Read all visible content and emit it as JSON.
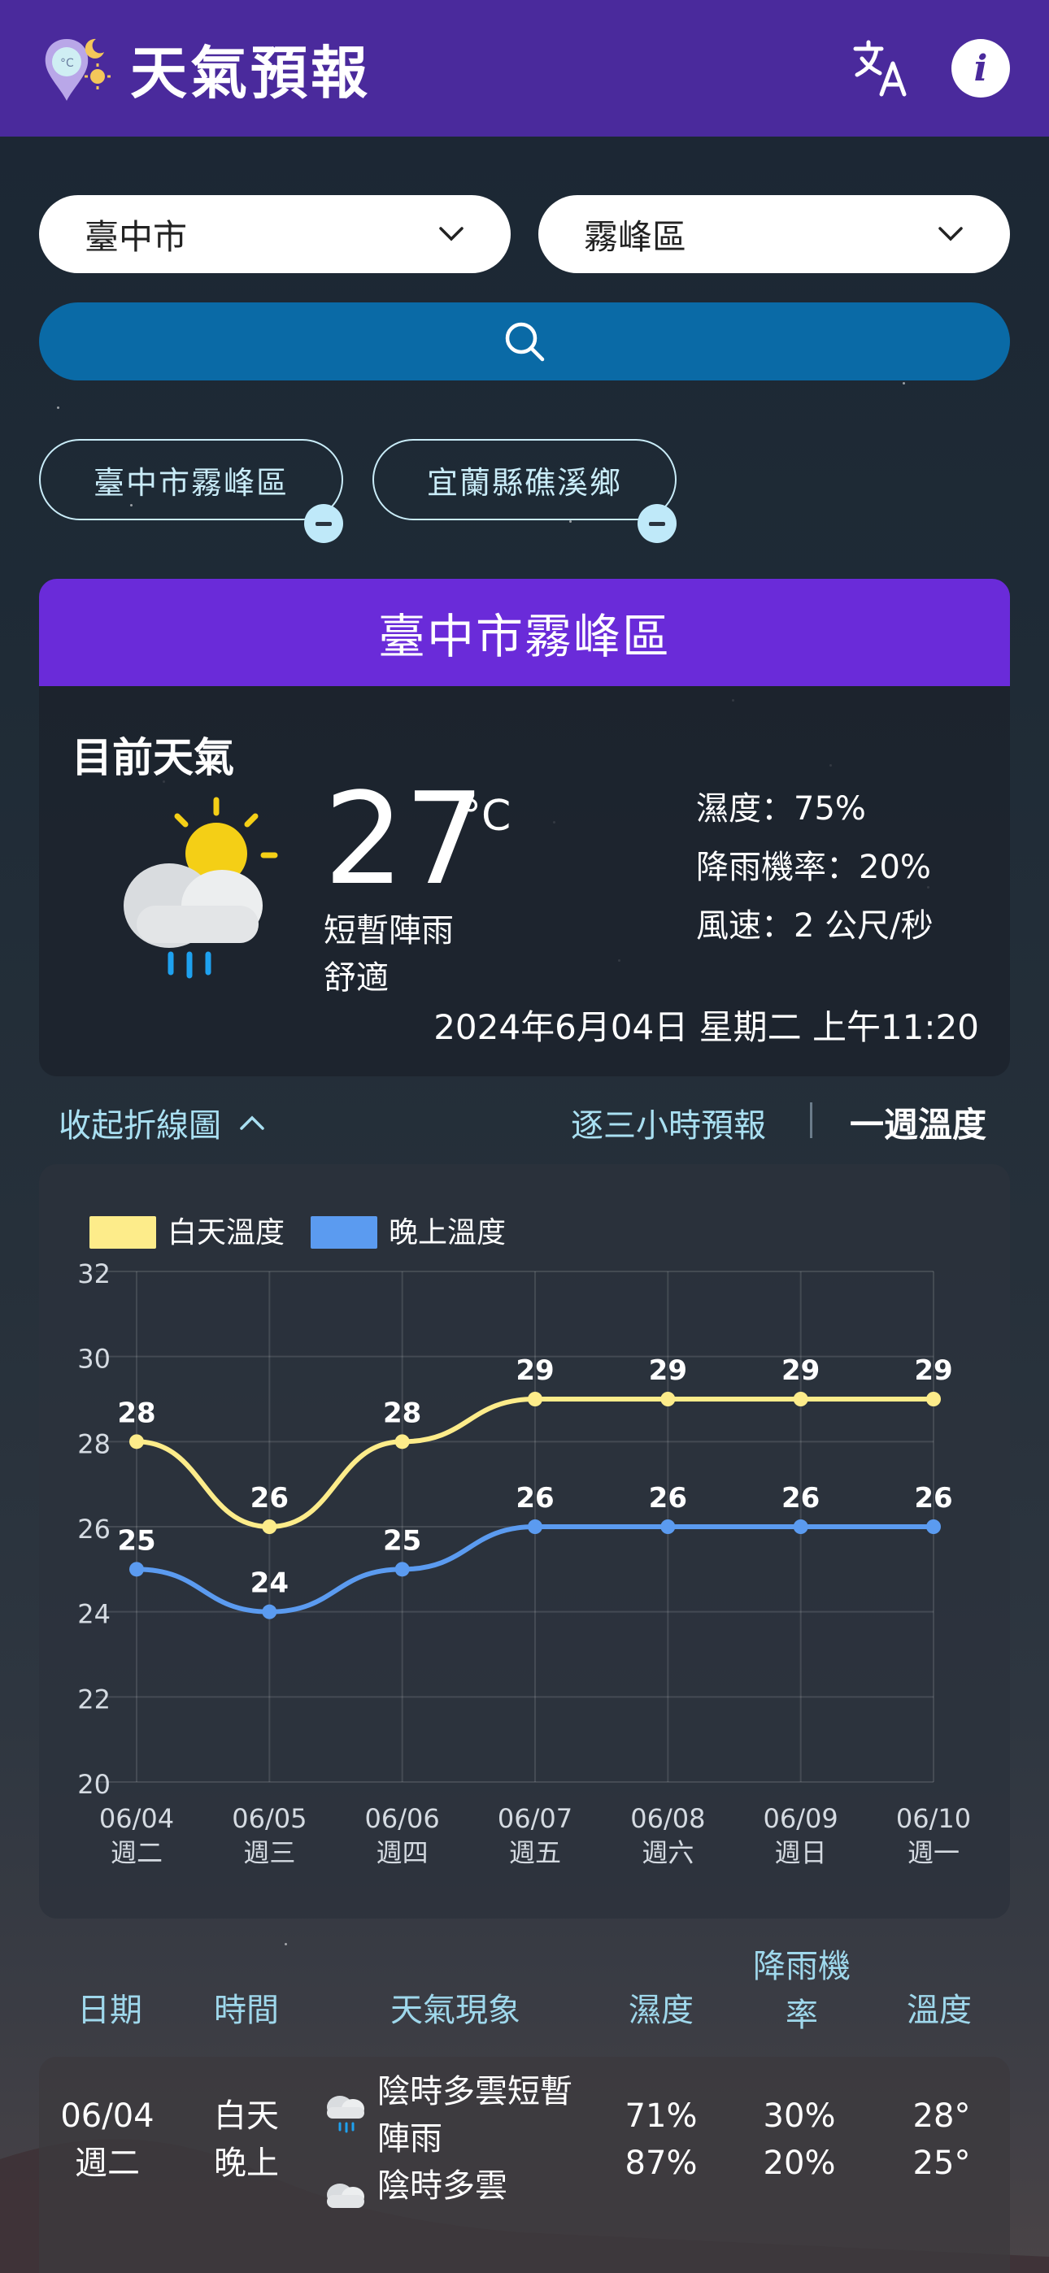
{
  "header": {
    "title": "天氣預報",
    "translate_icon": "translate-icon",
    "info_label": "i"
  },
  "selectors": {
    "city": "臺中市",
    "district": "霧峰區"
  },
  "search": {
    "icon": "search-icon"
  },
  "favorites": [
    {
      "label": "臺中市霧峰區"
    },
    {
      "label": "宜蘭縣礁溪鄉"
    }
  ],
  "current": {
    "location": "臺中市霧峰區",
    "label": "目前天氣",
    "temp": "27",
    "unit": "°C",
    "desc": "短暫陣雨",
    "comfort": "舒適",
    "humidity": "濕度：75%",
    "rain": "降雨機率：20%",
    "wind": "風速：2 公尺/秒",
    "datetime": "2024年6月04日 星期二 上午11:20"
  },
  "tabs": {
    "collapse": "收起折線圖",
    "three_hour": "逐三小時預報",
    "week": "一週溫度"
  },
  "colors": {
    "header": "#4a2a9c",
    "accent": "#6a2bd9",
    "day": "#fdec8a",
    "night": "#5b9bf0"
  },
  "chart_data": {
    "type": "line",
    "categories": [
      "06/04",
      "06/05",
      "06/06",
      "06/07",
      "06/08",
      "06/09",
      "06/10"
    ],
    "category_sub": [
      "週二",
      "週三",
      "週四",
      "週五",
      "週六",
      "週日",
      "週一"
    ],
    "series": [
      {
        "name": "白天溫度",
        "values": [
          28,
          26,
          28,
          29,
          29,
          29,
          29
        ]
      },
      {
        "name": "晚上溫度",
        "values": [
          25,
          24,
          25,
          26,
          26,
          26,
          26
        ]
      }
    ],
    "ylim": [
      20,
      32
    ],
    "yticks": [
      20,
      22,
      24,
      26,
      28,
      30,
      32
    ],
    "grid": true,
    "legend": "top-left",
    "smooth": true
  },
  "table": {
    "headers": [
      "日期",
      "時間",
      "天氣現象",
      "濕度",
      "降雨機",
      "率",
      "溫度"
    ],
    "row": {
      "date": "06/04",
      "weekday": "週二",
      "day_label": "白天",
      "night_label": "晚上",
      "day_wx_1": "陰時多雲短暫",
      "day_wx_2": "陣雨",
      "night_wx": "陰時多雲",
      "day_humidity": "71%",
      "night_humidity": "87%",
      "day_rain": "30%",
      "night_rain": "20%",
      "day_temp": "28°",
      "night_temp": "25°"
    }
  }
}
